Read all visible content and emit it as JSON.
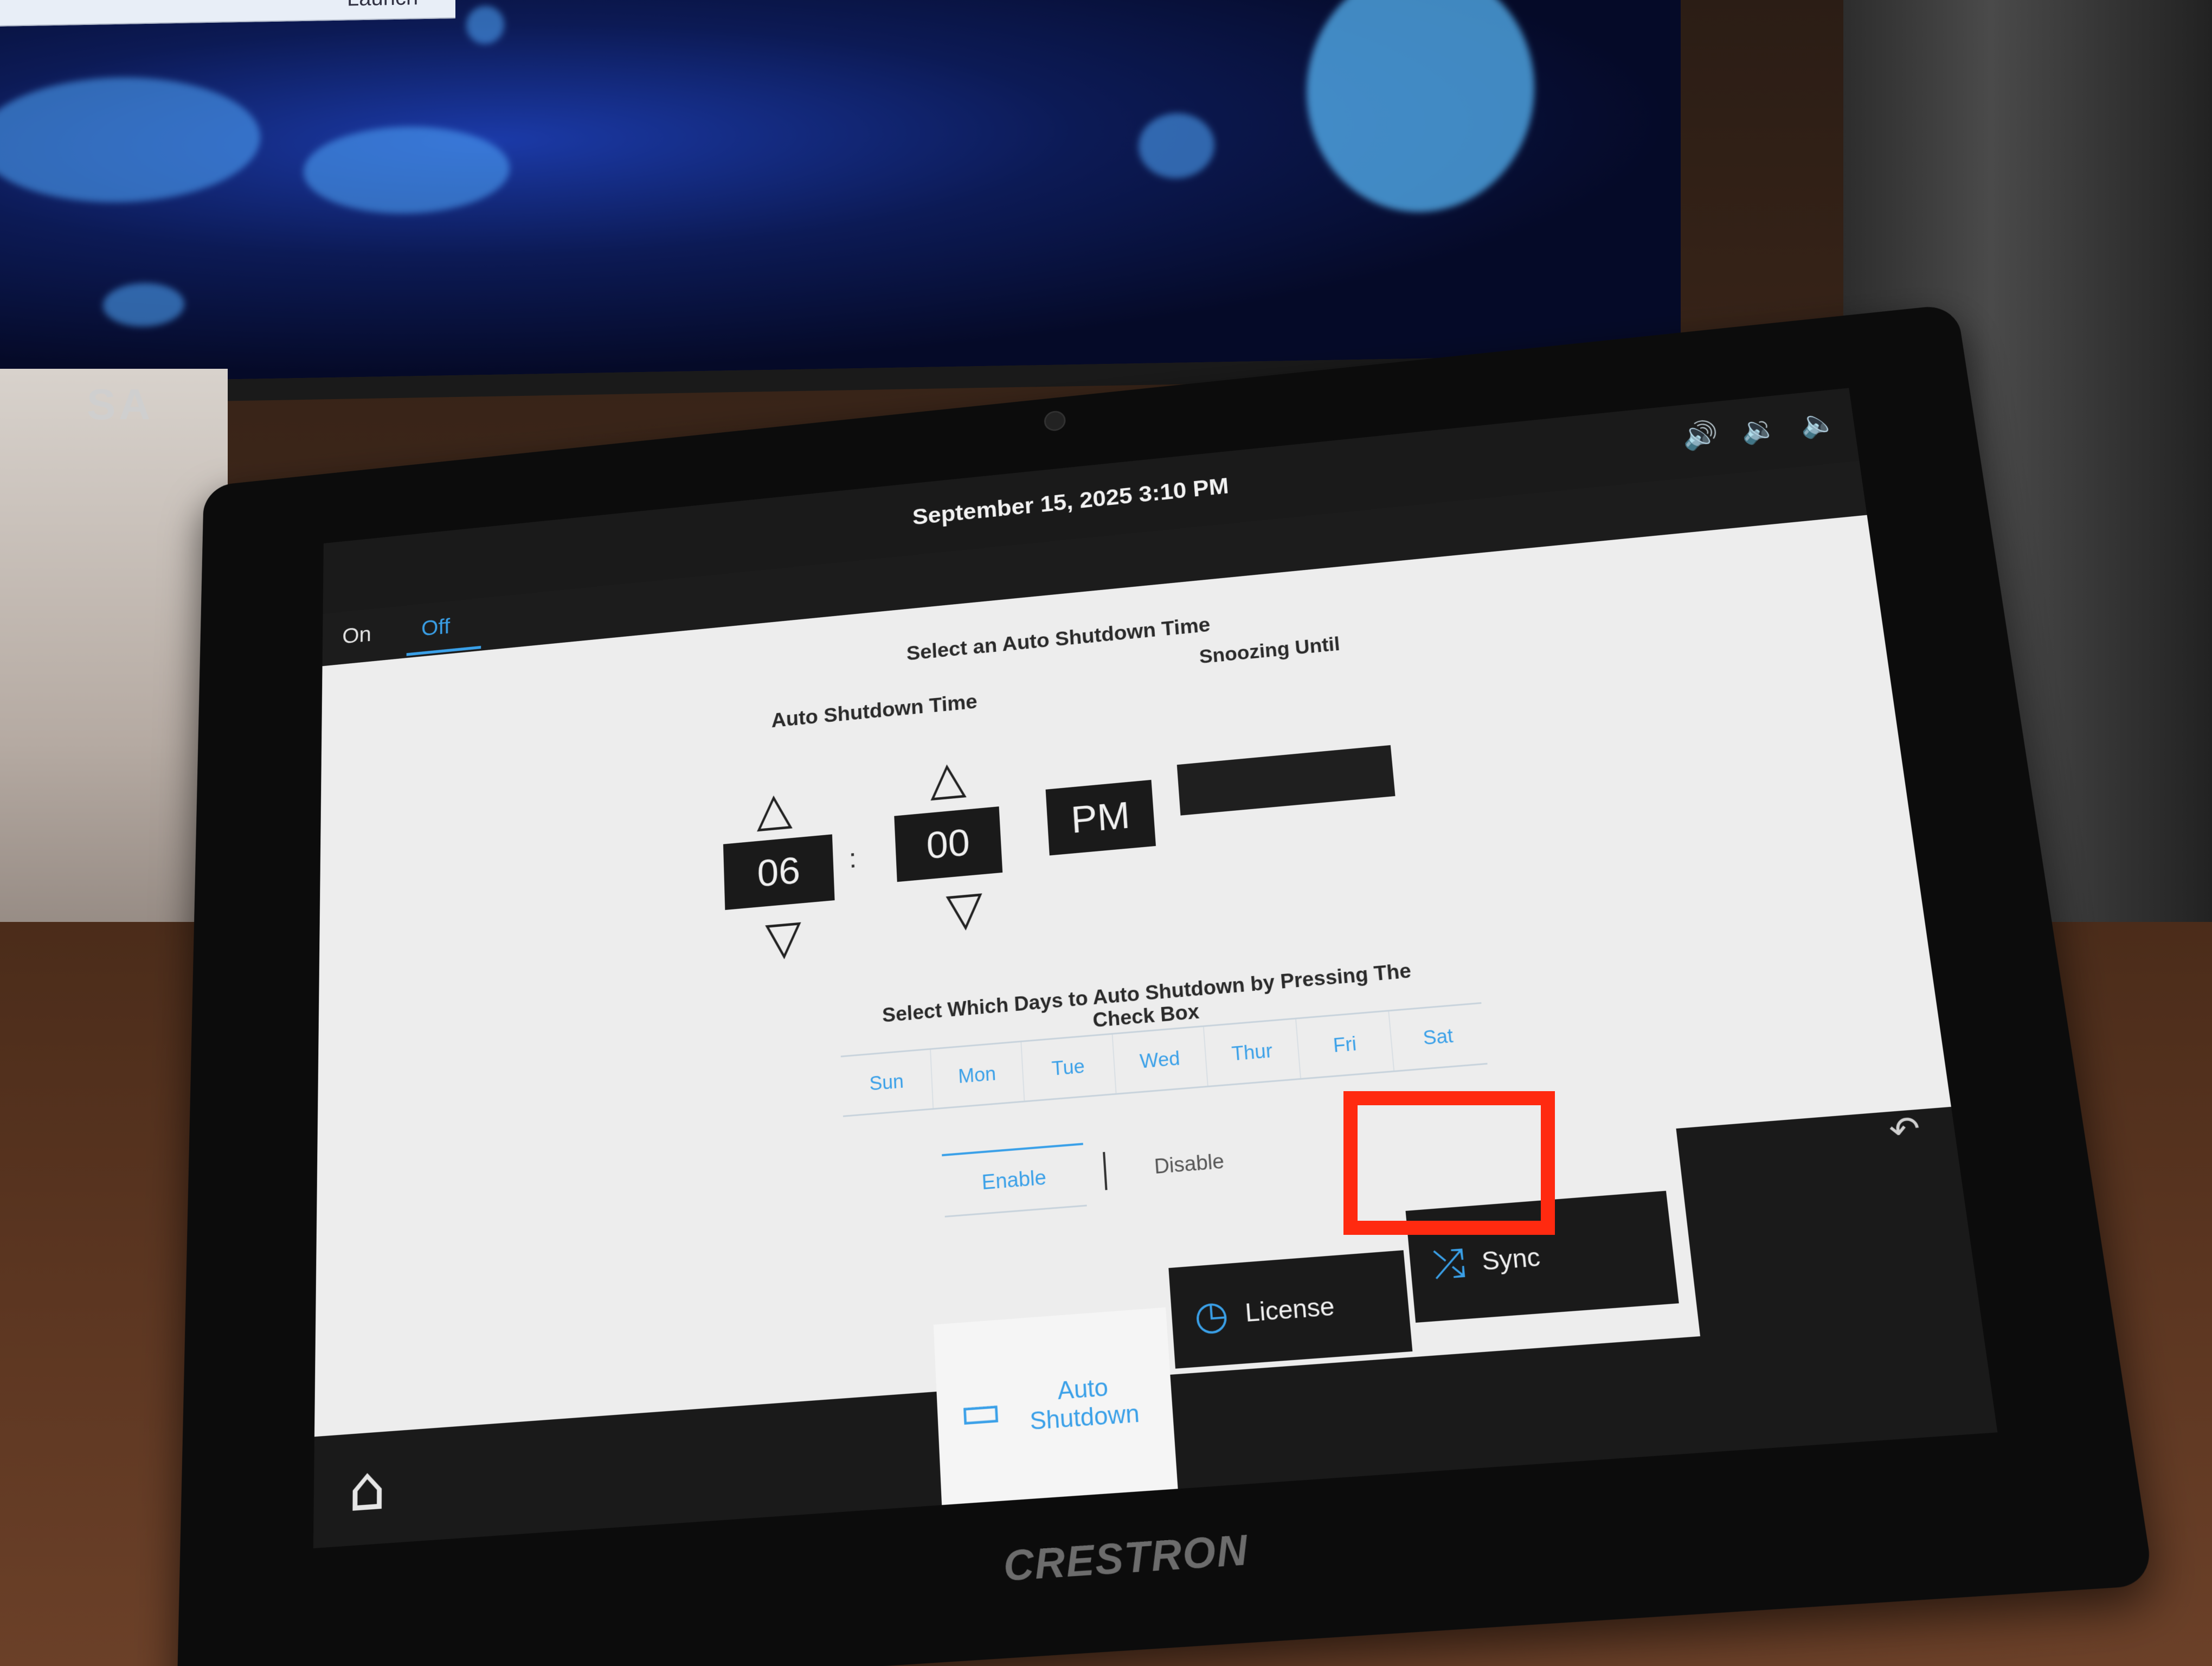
{
  "background": {
    "launch_label": "Launch",
    "monitor_brand": "SA"
  },
  "device": {
    "brand": "CRESTRON"
  },
  "status_bar": {
    "datetime": "September 15, 2025 3:10 PM",
    "volume_icons": [
      "volume-mute-toggle-icon",
      "volume-down-icon",
      "volume-up-icon"
    ],
    "volume_glyphs": {
      "toggle": "🔊",
      "down": "🔉",
      "up": "🔈"
    }
  },
  "power_toggle": {
    "on_label": "On",
    "off_label": "Off",
    "selected": "Off"
  },
  "auto_shutdown": {
    "section_title": "Select an Auto Shutdown Time",
    "time_label": "Auto Shutdown Time",
    "snoozing_label": "Snoozing Until",
    "hour": "06",
    "minute": "00",
    "ampm": "PM",
    "colon": ":",
    "arrow_up": "△",
    "arrow_down": "▽",
    "snooze_value": ""
  },
  "days": {
    "heading": "Select Which Days to Auto Shutdown by Pressing The Check Box",
    "items": [
      "Sun",
      "Mon",
      "Tue",
      "Wed",
      "Thur",
      "Fri",
      "Sat"
    ]
  },
  "enable_toggle": {
    "enable_label": "Enable",
    "disable_label": "Disable",
    "selected": "Enable"
  },
  "navigation": {
    "back_glyph": "↶",
    "home_glyph": "⌂",
    "tabs": [
      {
        "label": "Auto Shutdown",
        "icon": "monitor-icon",
        "glyph": "▭",
        "active": true
      },
      {
        "label": "License",
        "icon": "clock-icon",
        "glyph": "◷",
        "active": false
      },
      {
        "label": "Sync",
        "icon": "shuffle-icon",
        "glyph": "⤮",
        "active": false
      }
    ]
  },
  "colors": {
    "accent": "#3aa0e8",
    "highlight": "#ff2a10",
    "panel_dark": "#1a1a1a",
    "screen_bg": "#ededed"
  }
}
